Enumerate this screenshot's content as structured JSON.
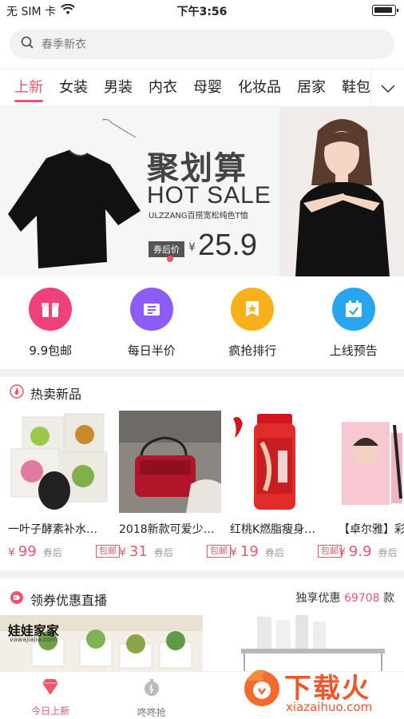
{
  "status_bar": {
    "carrier": "无 SIM 卡",
    "time": "下午3:56"
  },
  "search": {
    "placeholder": "春季新衣"
  },
  "categories": [
    "上新",
    "女装",
    "男装",
    "内衣",
    "母婴",
    "化妆品",
    "居家",
    "鞋包"
  ],
  "banner": {
    "title": "聚划算",
    "subtitle": "HOT SALE",
    "desc": "ULZZANG百搭宽松纯色T恤",
    "price_tag": "券后价",
    "currency": "¥",
    "price": "25.9"
  },
  "quick_entries": [
    {
      "label": "9.9包邮",
      "icon": "gift-box-icon",
      "color": "#f0407a"
    },
    {
      "label": "每日半价",
      "icon": "ticket-icon",
      "color": "#8d5cf5"
    },
    {
      "label": "疯抢排行",
      "icon": "star-badge-icon",
      "color": "#f7b11a"
    },
    {
      "label": "上线预告",
      "icon": "calendar-icon",
      "color": "#27a6ef"
    }
  ],
  "hot_section": {
    "title": "热卖新品"
  },
  "products": [
    {
      "name": "一叶子酵素补水…",
      "currency": "¥",
      "price": "99",
      "after": "券后",
      "shipping": "包邮"
    },
    {
      "name": "2018新款可爱少…",
      "currency": "¥",
      "price": "31",
      "after": "券后",
      "shipping": "包邮"
    },
    {
      "name": "红桃K燃脂瘦身…",
      "currency": "¥",
      "price": "19",
      "after": "券后",
      "shipping": "包邮"
    },
    {
      "name": "【卓尔雅】彩",
      "currency": "¥",
      "price": "9.9",
      "after": "券后",
      "shipping": ""
    }
  ],
  "coupon_section": {
    "title": "领券优惠直播",
    "prefix": "独享优惠",
    "count": "69708",
    "suffix": "款"
  },
  "coupon_images": {
    "left_brand": "娃娃家家",
    "left_url": "vawajiajia.com"
  },
  "tabbar": [
    {
      "label": "今日上新",
      "icon": "heart-gem-icon",
      "active": true
    },
    {
      "label": "咚咚抢",
      "icon": "timer-icon",
      "active": false
    }
  ],
  "watermark": {
    "text": "下载火",
    "url": "xiazaihuo.com"
  },
  "colors": {
    "accent": "#f2536c"
  }
}
